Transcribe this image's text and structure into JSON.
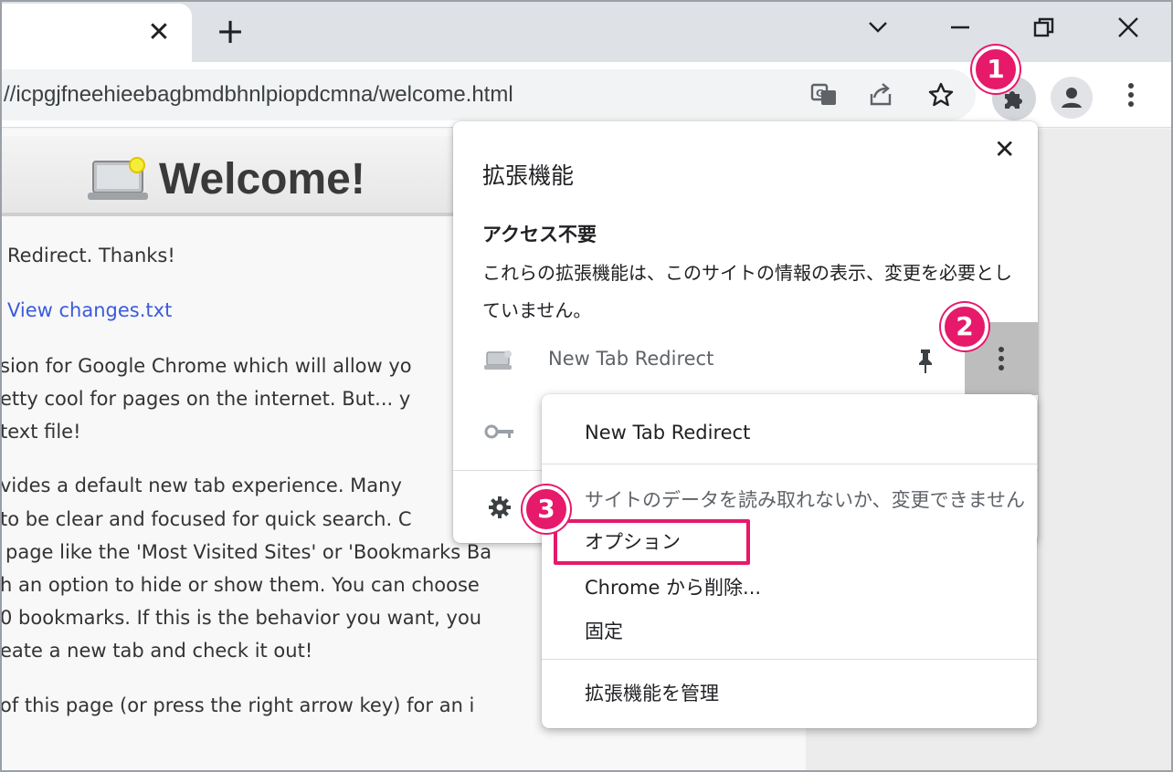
{
  "browser": {
    "url": "//icpgjfneehieebagbmdbhnlpiopdcmna/welcome.html",
    "tab_close_glyph": "✕",
    "new_tab_glyph": "+"
  },
  "page": {
    "title": "Welcome!",
    "lines": [
      "Redirect. Thanks!",
      "View changes.txt",
      "sion for Google Chrome which will allow yo",
      "etty cool for pages on the internet. But... y",
      "text file!",
      "vides a default new tab experience. Many",
      "to be clear and focused for quick search. C",
      "page like the 'Most Visited Sites' or 'Bookmarks Ba",
      "h an option to hide or show them. You can choose",
      "0 bookmarks. If this is the behavior you want, you",
      "eate a new tab and check it out!",
      "of this page (or press the right arrow key) for an i"
    ]
  },
  "extensions_popup": {
    "title": "拡張機能",
    "close_glyph": "✕",
    "section_title": "アクセス不要",
    "section_desc": "これらの拡張機能は、このサイトの情報の表示、変更を必要としていません。",
    "item_name": "New Tab Redirect"
  },
  "context_menu": {
    "header": "New Tab Redirect",
    "note": "サイトのデータを読み取れないか、変更できません",
    "options": "オプション",
    "remove": "Chrome から削除...",
    "pin": "固定",
    "manage": "拡張機能を管理"
  },
  "badges": [
    "1",
    "2",
    "3"
  ],
  "colors": {
    "accent": "#e6196b",
    "link": "#3b5bdb"
  },
  "icons": [
    "close-icon",
    "plus-icon",
    "chevron-down-icon",
    "minimize-icon",
    "restore-icon",
    "translate-icon",
    "share-icon",
    "star-icon",
    "puzzle-icon",
    "profile-icon",
    "kebab-menu-icon",
    "pin-icon",
    "gear-icon",
    "laptop-icon",
    "key-icon"
  ]
}
